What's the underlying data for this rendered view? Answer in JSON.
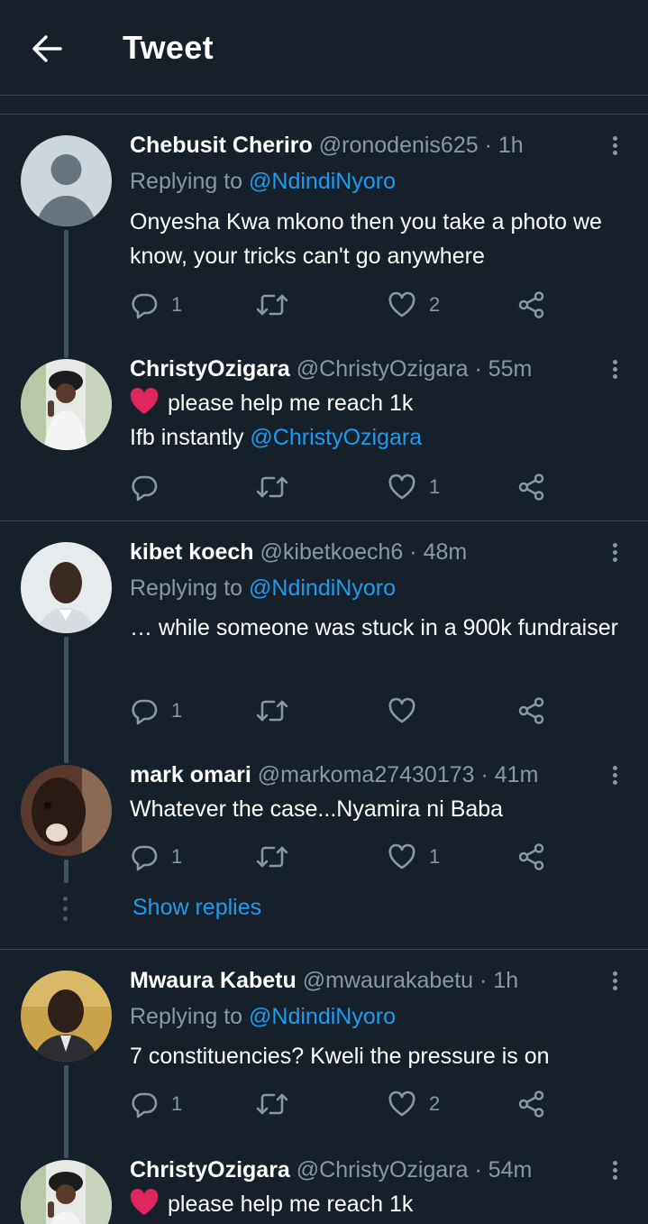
{
  "header": {
    "title": "Tweet"
  },
  "tweets": [
    {
      "name": "Chebusit Cheriro",
      "handle": "@ronodenis625",
      "dot": "·",
      "time": "1h",
      "replying_prefix": "Replying to",
      "replying_to": "@NdindiNyoro",
      "text": "Onyesha Kwa mkono then you take a photo we know, your tricks can't go anywhere",
      "replies": "1",
      "retweets": "",
      "likes": "2"
    },
    {
      "name": "ChristyOzigara",
      "handle": "@ChristyOzigara",
      "dot": "·",
      "time": "55m",
      "line1": "please help me reach 1k",
      "line2_prefix": "Ifb instantly",
      "line2_mention": "@ChristyOzigara",
      "replies": "",
      "retweets": "",
      "likes": "1"
    },
    {
      "name": "kibet koech",
      "handle": "@kibetkoech6",
      "dot": "·",
      "time": "48m",
      "replying_prefix": "Replying to",
      "replying_to": "@NdindiNyoro",
      "text": "… while someone was stuck in a 900k fundraiser",
      "replies": "1",
      "retweets": "",
      "likes": ""
    },
    {
      "name": "mark omari",
      "handle": "@markoma27430173",
      "dot": "·",
      "time": "41m",
      "text": "Whatever the case...Nyamira ni Baba",
      "replies": "1",
      "retweets": "",
      "likes": "1"
    },
    {
      "name": "Mwaura Kabetu",
      "handle": "@mwaurakabetu",
      "dot": "·",
      "time": "1h",
      "replying_prefix": "Replying to",
      "replying_to": "@NdindiNyoro",
      "text": "7 constituencies? Kweli the pressure is on",
      "replies": "1",
      "retweets": "",
      "likes": "2"
    },
    {
      "name": "ChristyOzigara",
      "handle": "@ChristyOzigara",
      "dot": "·",
      "time": "54m",
      "line1": "please help me reach 1k"
    }
  ],
  "show_replies_label": "Show replies",
  "colors": {
    "background": "#15202b",
    "accent": "#1d9bf0",
    "muted": "#8899a6",
    "divider": "#38444d",
    "heart": "#e0245e"
  },
  "icons": [
    "back-arrow-icon",
    "more-vertical-icon",
    "reply-icon",
    "retweet-icon",
    "like-icon",
    "share-icon",
    "red-heart-emoji-icon"
  ]
}
